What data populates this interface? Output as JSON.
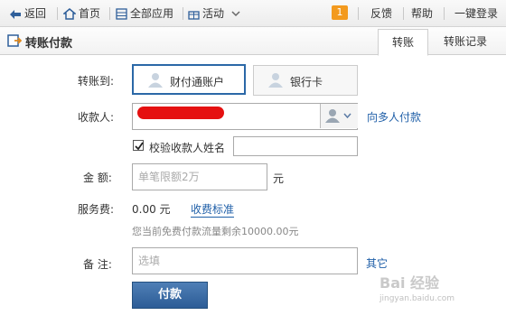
{
  "topbar": {
    "back": "返回",
    "home": "首页",
    "all_apps": "全部应用",
    "activity": "活动",
    "badge_count": "1",
    "feedback": "反馈",
    "help": "帮助",
    "login": "一键登录"
  },
  "header": {
    "title": "转账付款",
    "tabs": [
      {
        "label": "转账",
        "active": true
      },
      {
        "label": "转账记录",
        "active": false
      }
    ]
  },
  "form": {
    "transfer_to_label": "转账到:",
    "types": [
      {
        "label": "财付通账户",
        "selected": true
      },
      {
        "label": "银行卡",
        "selected": false
      }
    ],
    "payee_label": "收款人:",
    "multi_pay_link": "向多人付款",
    "verify_name_label": "校验收款人姓名",
    "verify_checked": true,
    "amount_label": "金  额:",
    "amount_placeholder": "单笔限额2万",
    "amount_unit": "元",
    "fee_label": "服务费:",
    "fee_value": "0.00 元",
    "fee_standard_link": "收费标准",
    "fee_hint": "您当前免费付款流量剩余10000.00元",
    "note_label": "备  注:",
    "note_placeholder": "选填",
    "other_link": "其它",
    "submit_label": "付款"
  },
  "watermark": {
    "text": "Bai 经验",
    "url": "jingyan.baidu.com"
  },
  "colors": {
    "accent": "#2b68a7",
    "badge": "#f39a1e",
    "link": "#1f5fa8",
    "redaction": "#e51010"
  }
}
